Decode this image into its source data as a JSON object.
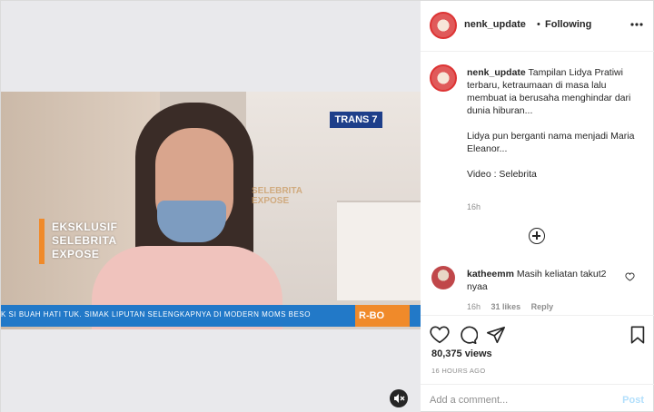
{
  "post": {
    "username": "nenk_update",
    "dot": "•",
    "follow_status": "Following",
    "more_icon": "more-horizontal-icon"
  },
  "media": {
    "channel_logo": "TRANS 7",
    "watermark_line1": "SELEBRITA",
    "watermark_line2": "EXPOSE",
    "show_title_line1": "EKSKLUSIF",
    "show_title_line2": "SELEBRITA",
    "show_title_line3": "EXPOSE",
    "ticker_text": "K SI BUAH HATI TUK. SIMAK LIPUTAN SELENGKAPNYA DI MODERN MOMS BESO",
    "ticker_tag": "R-BO",
    "ticker_color": "#2279c8",
    "tag_color": "#f08a2a",
    "mute_icon": "muted-speaker-icon"
  },
  "caption": {
    "username": "nenk_update",
    "paragraph1": "Tampilan Lidya Pratiwi terbaru, ketraumaan di masa lalu membuat ia berusaha menghindar dari dunia hiburan...",
    "paragraph2": "Lidya pun berganti nama menjadi Maria Eleanor...",
    "paragraph3": "Video : Selebrita",
    "time": "16h"
  },
  "comment": {
    "username": "katheemm",
    "text": "Masih keliatan takut2 nyaa",
    "time": "16h",
    "likes": "31 likes",
    "reply": "Reply"
  },
  "stats": {
    "views": "80,375 views",
    "posted_ago": "16 HOURS AGO"
  },
  "compose": {
    "placeholder": "Add a comment...",
    "post_label": "Post",
    "post_color": "#b2dffc"
  }
}
